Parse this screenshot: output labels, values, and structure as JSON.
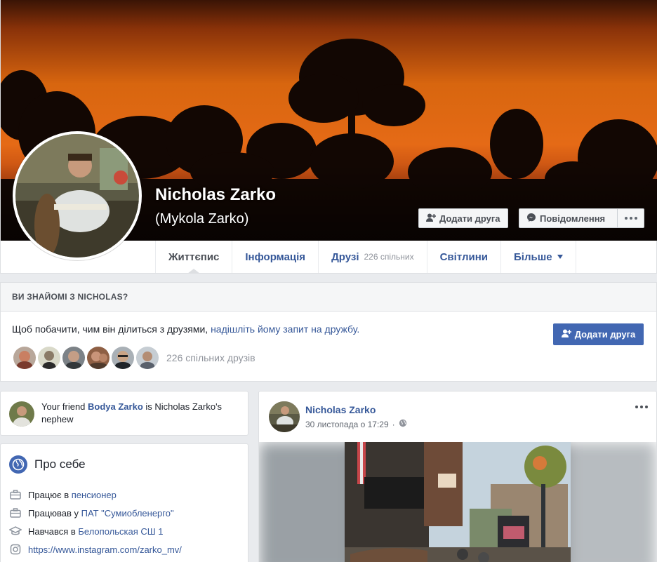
{
  "profile": {
    "name": "Nicholas Zarko",
    "alternate_name": "(Mykola Zarko)"
  },
  "actions": {
    "add_friend": "Додати друга",
    "message": "Повідомлення"
  },
  "tabs": [
    {
      "label": "Життєпис",
      "active": true
    },
    {
      "label": "Інформація"
    },
    {
      "label": "Друзі",
      "sub": "226 спільних"
    },
    {
      "label": "Світлини"
    },
    {
      "label": "Більше"
    }
  ],
  "know_panel": {
    "heading": "ВИ ЗНАЙОМІ З NICHOLAS?",
    "text": "Щоб побачити, чим він ділиться з друзями, ",
    "link": "надішліть йому запит на дружбу.",
    "button": "Додати друга",
    "mutual_count": "226 спільних друзів"
  },
  "relation": {
    "prefix": "Your friend ",
    "friend": "Bodya Zarko",
    "suffix": " is Nicholas Zarko's nephew"
  },
  "about": {
    "title": "Про себе",
    "rows": [
      {
        "icon": "briefcase-icon",
        "prefix": "Працює в ",
        "link": "пенсионер"
      },
      {
        "icon": "briefcase-icon",
        "prefix": "Працював у ",
        "link": "ПАТ \"Сумиобленерго\""
      },
      {
        "icon": "graduation-cap-icon",
        "prefix": "Навчався в ",
        "link": "Белопольская СШ 1"
      },
      {
        "icon": "instagram-icon",
        "prefix": "",
        "link": "https://www.instagram.com/zarko_mv/"
      }
    ]
  },
  "post": {
    "author": "Nicholas Zarko",
    "time": "30 листопада о 17:29",
    "separator": "·"
  },
  "colors": {
    "link": "#365899",
    "primary_button": "#4267b2",
    "page_background": "#e9ebee"
  }
}
